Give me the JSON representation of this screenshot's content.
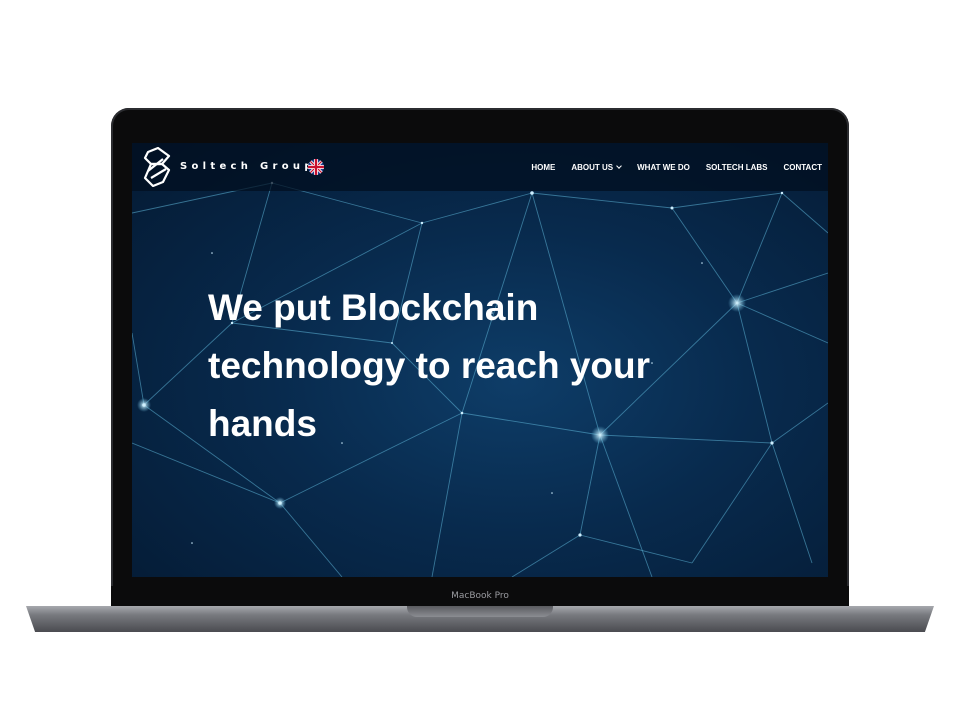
{
  "device": {
    "model_label": "MacBook Pro"
  },
  "site": {
    "brand": "Soltech Group",
    "language_flag_icon": "uk-flag-icon",
    "nav": {
      "home": "HOME",
      "about": "ABOUT US",
      "what": "WHAT WE DO",
      "labs": "SOLTECH LABS",
      "contact": "CONTACT"
    },
    "hero": {
      "line1": "We put Blockchain",
      "line2": "technology to reach your",
      "line3": "hands"
    }
  },
  "colors": {
    "background_dark": "#041a33",
    "background_mid": "#0e3d68",
    "network_lines": "#5fb7d9",
    "text": "#ffffff"
  }
}
